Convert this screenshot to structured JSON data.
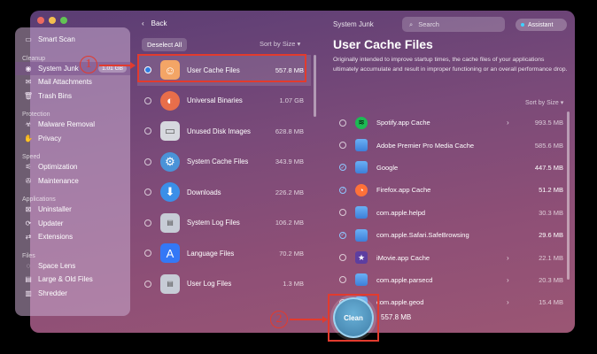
{
  "sidebar": {
    "smart_scan": "Smart Scan",
    "sections": {
      "cleanup": "Cleanup",
      "protection": "Protection",
      "speed": "Speed",
      "applications": "Applications",
      "files": "Files"
    },
    "items": {
      "system_junk": "System Junk",
      "system_junk_badge": "1.01 GB",
      "mail_attachments": "Mail Attachments",
      "trash_bins": "Trash Bins",
      "malware_removal": "Malware Removal",
      "privacy": "Privacy",
      "optimization": "Optimization",
      "maintenance": "Maintenance",
      "uninstaller": "Uninstaller",
      "updater": "Updater",
      "extensions": "Extensions",
      "space_lens": "Space Lens",
      "large_old_files": "Large & Old Files",
      "shredder": "Shredder"
    }
  },
  "middle": {
    "back_label": "Back",
    "deselect_label": "Deselect All",
    "sort_label": "Sort by Size",
    "rows": [
      {
        "name": "User Cache Files",
        "size": "557.8 MB"
      },
      {
        "name": "Universal Binaries",
        "size": "1.07 GB"
      },
      {
        "name": "Unused Disk Images",
        "size": "628.8 MB"
      },
      {
        "name": "System Cache Files",
        "size": "343.9 MB"
      },
      {
        "name": "Downloads",
        "size": "226.2 MB"
      },
      {
        "name": "System Log Files",
        "size": "106.2 MB"
      },
      {
        "name": "Language Files",
        "size": "70.2 MB"
      },
      {
        "name": "User Log Files",
        "size": "1.3 MB"
      }
    ]
  },
  "right": {
    "window_title": "System Junk",
    "search_placeholder": "Search",
    "assistant_label": "Assistant",
    "heading": "User Cache Files",
    "description": "Originally intended to improve startup times, the cache files of your applications ultimately accumulate and result in improper functioning or an overall performance drop.",
    "sort_label": "Sort by Size",
    "rows": [
      {
        "name": "Spotify.app Cache",
        "size": "993.5 MB"
      },
      {
        "name": "Adobe Premier Pro Media Cache",
        "size": "585.6 MB"
      },
      {
        "name": "Google",
        "size": "447.5 MB"
      },
      {
        "name": "Firefox.app Cache",
        "size": "51.2 MB"
      },
      {
        "name": "com.apple.helpd",
        "size": "30.3 MB"
      },
      {
        "name": "com.apple.Safari.SafeBrowsing",
        "size": "29.6 MB"
      },
      {
        "name": "iMovie.app Cache",
        "size": "22.1 MB"
      },
      {
        "name": "com.apple.parsecd",
        "size": "20.3 MB"
      },
      {
        "name": "com.apple.geod",
        "size": "15.4 MB"
      }
    ]
  },
  "bottom": {
    "clean_label": "Clean",
    "total_size": "557.8 MB"
  },
  "annotations": {
    "step1": "1",
    "step2": "2"
  },
  "colors": {
    "annotation_red": "#e23b2e",
    "selection_blue": "#2f7de1"
  }
}
